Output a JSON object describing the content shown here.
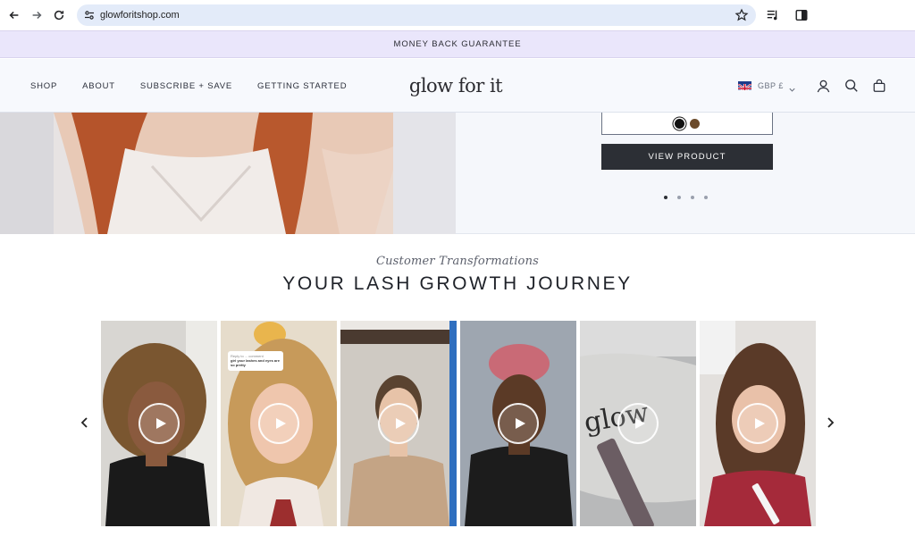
{
  "browser": {
    "url": "glowforitshop.com",
    "icons": [
      "back-icon",
      "forward-icon",
      "reload-icon",
      "site-settings-icon",
      "bookmark-star-icon",
      "media-controls-icon",
      "side-panel-icon"
    ]
  },
  "announcement": {
    "text": "MONEY BACK GUARANTEE"
  },
  "header": {
    "nav": [
      "SHOP",
      "ABOUT",
      "SUBSCRIBE + SAVE",
      "GETTING STARTED"
    ],
    "logo_text": "glow for it",
    "currency": "GBP £",
    "icons": [
      "uk-flag-icon",
      "chevron-down-icon",
      "account-icon",
      "search-icon",
      "cart-bag-icon"
    ]
  },
  "hero": {
    "swatches": [
      "#111111",
      "#6b4a2a"
    ],
    "button_label": "VIEW PRODUCT",
    "slide_count": 4,
    "active_slide": 1
  },
  "section": {
    "subtitle": "Customer Transformations",
    "title": "YOUR LASH GROWTH JOURNEY"
  },
  "videos": {
    "count": 6,
    "comment_bubble": {
      "line1": "Reply to ... comment",
      "line2": "girl your lashes and eyes are so pretty"
    },
    "icons": [
      "play-icon",
      "chevron-left-icon",
      "chevron-right-icon"
    ]
  },
  "colors": {
    "announcement_bg": "#eae6fb",
    "header_bg": "#f7f9fd",
    "button_bg": "#2c2f35",
    "url_bar_bg": "#e3ebf9"
  }
}
